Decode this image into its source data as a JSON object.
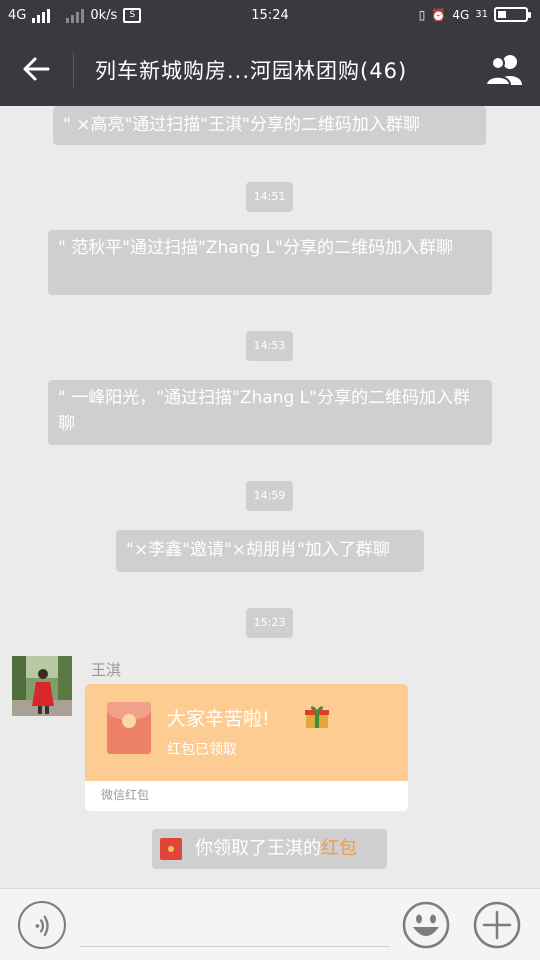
{
  "status_bar": {
    "network": "4G",
    "speed": "0k/s",
    "time": "15:24",
    "network_right": "4G",
    "battery": "31",
    "battery_level_percent": 31
  },
  "header": {
    "title": "列车新城购房...河园林团购(46)",
    "back_icon": "back-arrow-icon",
    "members_icon": "group-members-icon"
  },
  "chat": {
    "system_messages": [
      "\" ×高亮\"通过扫描\"王淇\"分享的二维码加入群聊",
      "\" 范秋平\"通过扫描\"Zhang L\"分享的二维码加入群聊",
      "\" 一峰阳光，\"通过扫描\"Zhang L\"分享的二维码加入群聊",
      "\"×李鑫\"邀请\"×胡朋肖\"加入了群聊"
    ],
    "timestamps": [
      "14:51",
      "14:53",
      "14:59",
      "15:23"
    ],
    "red_packet_message": {
      "sender": "王淇",
      "title": "大家辛苦啦!",
      "status": "红包已领取",
      "footer": "微信红包",
      "icon": "red-envelope-icon",
      "gift_icon": "gift-box-icon"
    },
    "received_notice": {
      "prefix": "你领取了王淇的",
      "highlight": "红包",
      "highlight_color": "#f39c3f"
    }
  },
  "input_bar": {
    "placeholder": "",
    "voice_icon": "voice-icon",
    "emoji_icon": "emoji-icon",
    "plus_icon": "plus-icon"
  },
  "colors": {
    "header_bg": "#393a3f",
    "chat_bg": "#ebebeb",
    "system_bubble": "#cfcfcf",
    "red_packet": "#fdcc93"
  }
}
